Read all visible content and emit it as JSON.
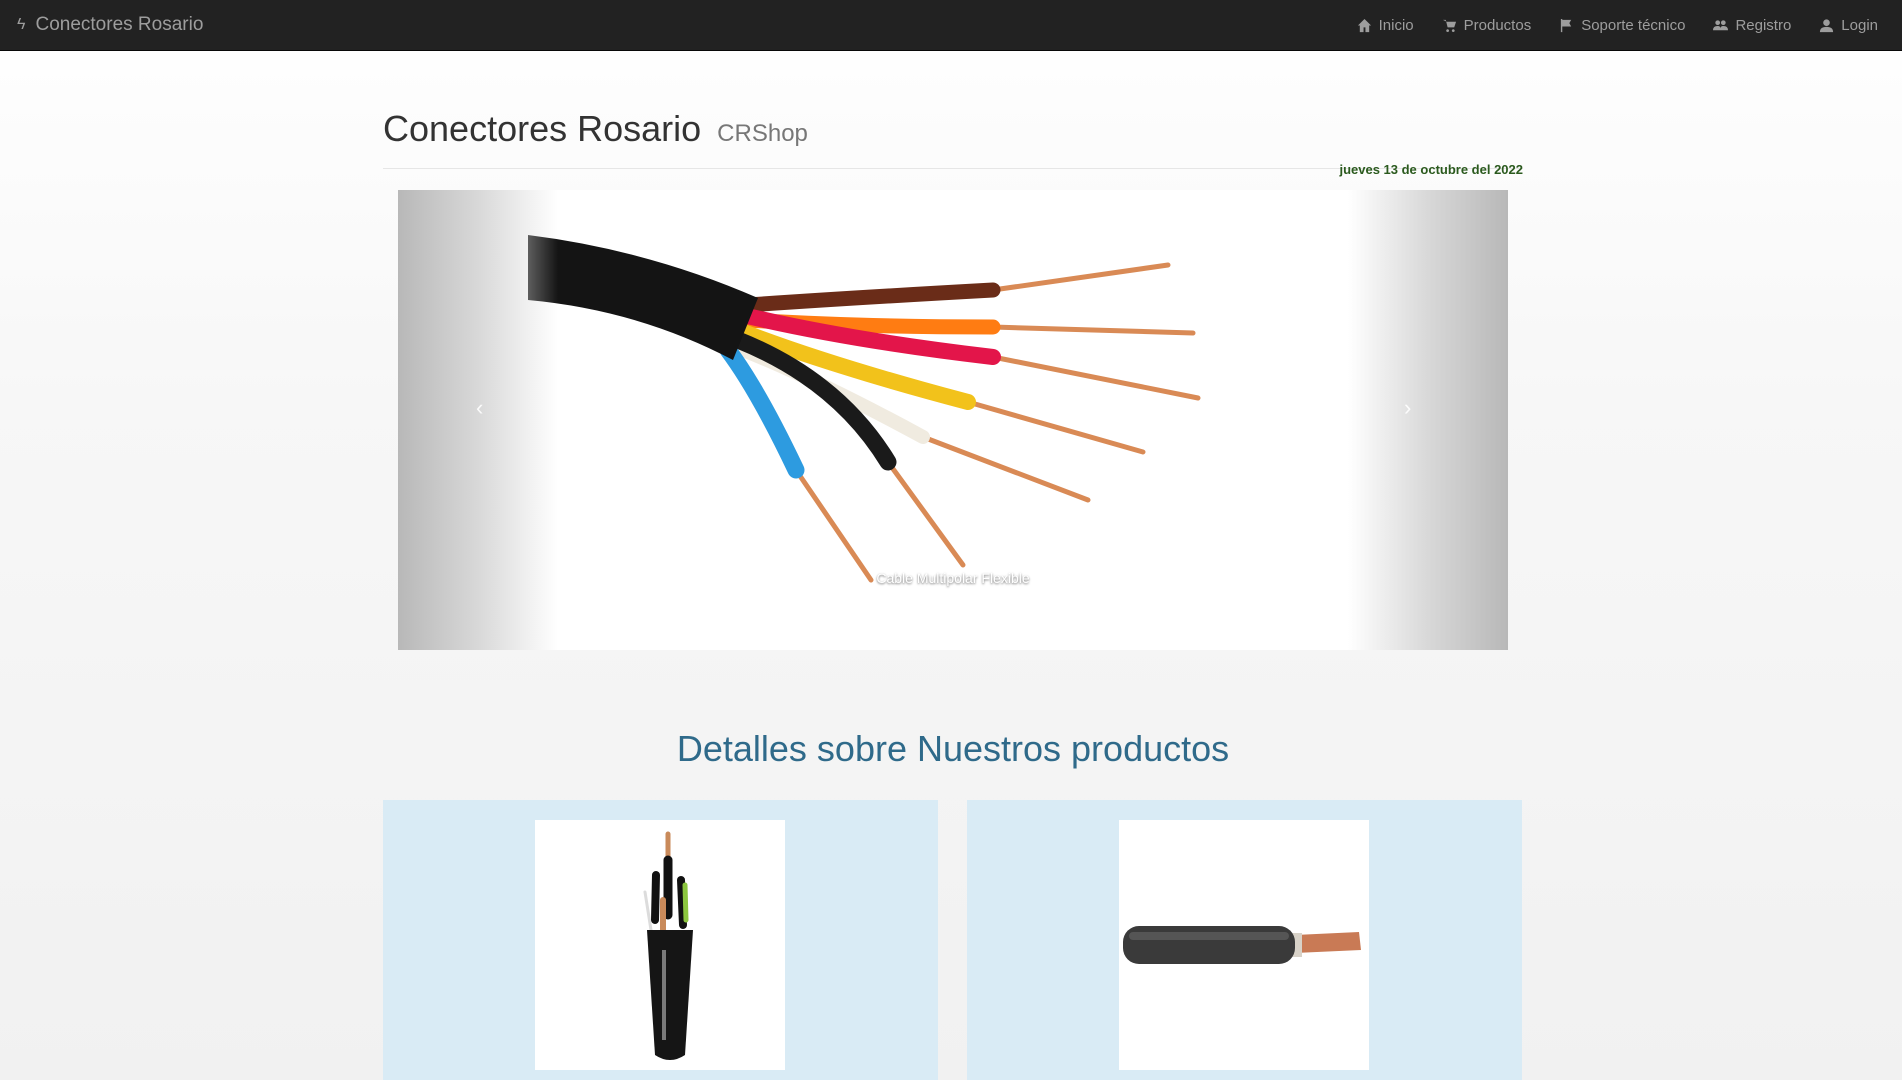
{
  "navbar": {
    "brand": "Conectores Rosario",
    "items": [
      {
        "label": "Inicio",
        "icon": "home-icon"
      },
      {
        "label": "Productos",
        "icon": "cart-icon"
      },
      {
        "label": "Soporte técnico",
        "icon": "flag-icon"
      },
      {
        "label": "Registro",
        "icon": "users-icon"
      },
      {
        "label": "Login",
        "icon": "user-icon"
      }
    ]
  },
  "header": {
    "title": "Conectores Rosario",
    "subtitle": "CRShop",
    "date": "jueves 13 de octubre del 2022"
  },
  "carousel": {
    "caption": "Cable Multipolar Flexible",
    "prev": "‹",
    "next": "›"
  },
  "products": {
    "title": "Detalles sobre Nuestros productos"
  },
  "colors": {
    "navbar_bg": "#222222",
    "section_title": "#2f6a8a",
    "card_bg": "#d9ebf5",
    "date": "#2b5a1e"
  }
}
